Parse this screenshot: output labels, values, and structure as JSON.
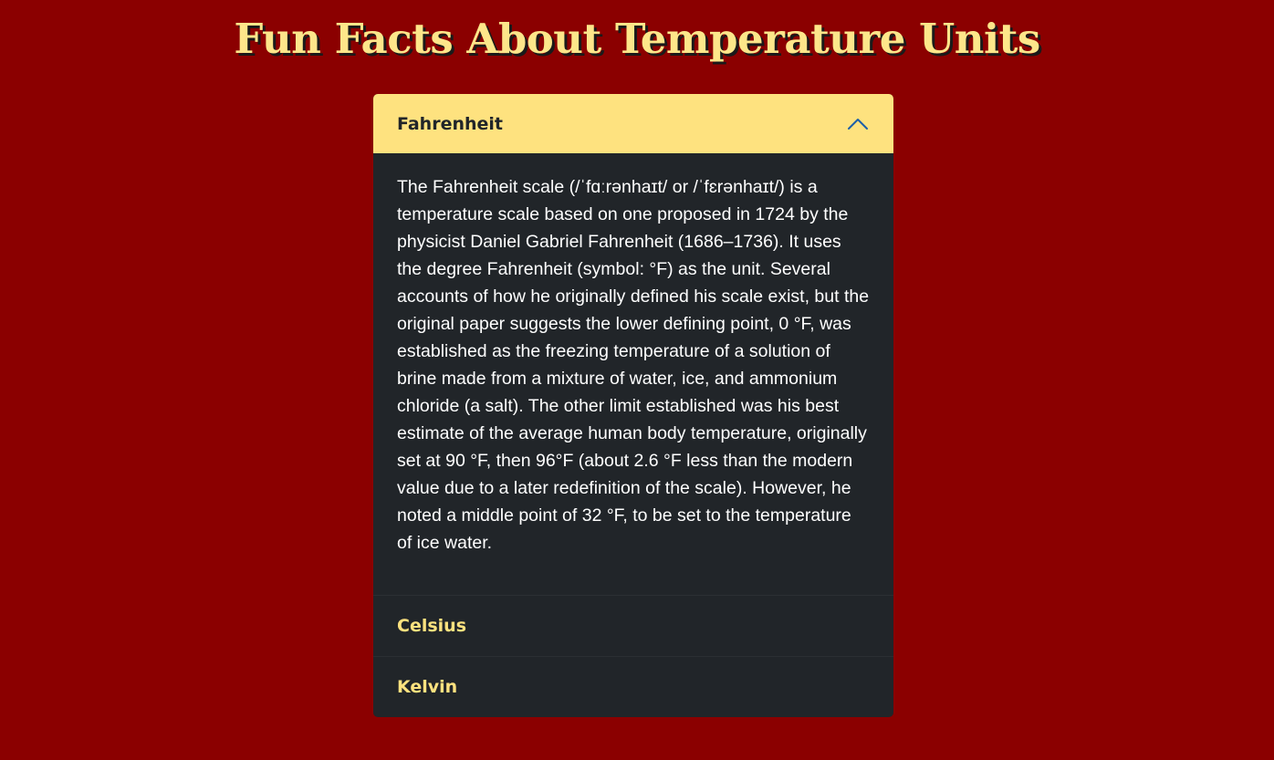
{
  "page": {
    "title": "Fun Facts About Temperature Units"
  },
  "accordion": {
    "items": [
      {
        "label": "Fahrenheit",
        "expanded": true,
        "content": "The Fahrenheit scale (/ˈfɑːrənhaɪt/ or /ˈfɛrənhaɪt/) is a temperature scale based on one proposed in 1724 by the physicist Daniel Gabriel Fahrenheit (1686–1736). It uses the degree Fahrenheit (symbol: °F) as the unit. Several accounts of how he originally defined his scale exist, but the original paper suggests the lower defining point, 0 °F, was established as the freezing temperature of a solution of brine made from a mixture of water, ice, and ammonium chloride (a salt). The other limit established was his best estimate of the average human body temperature, originally set at 90 °F, then 96°F (about 2.6 °F less than the modern value due to a later redefinition of the scale). However, he noted a middle point of 32 °F, to be set to the temperature of ice water."
      },
      {
        "label": "Celsius",
        "expanded": false
      },
      {
        "label": "Kelvin",
        "expanded": false
      }
    ]
  },
  "colors": {
    "background": "#8b0000",
    "accent": "#fee27f",
    "panel": "#212529",
    "chevron": "#1d5fa8"
  },
  "icons": {
    "expanded": "chevron-up-icon"
  }
}
